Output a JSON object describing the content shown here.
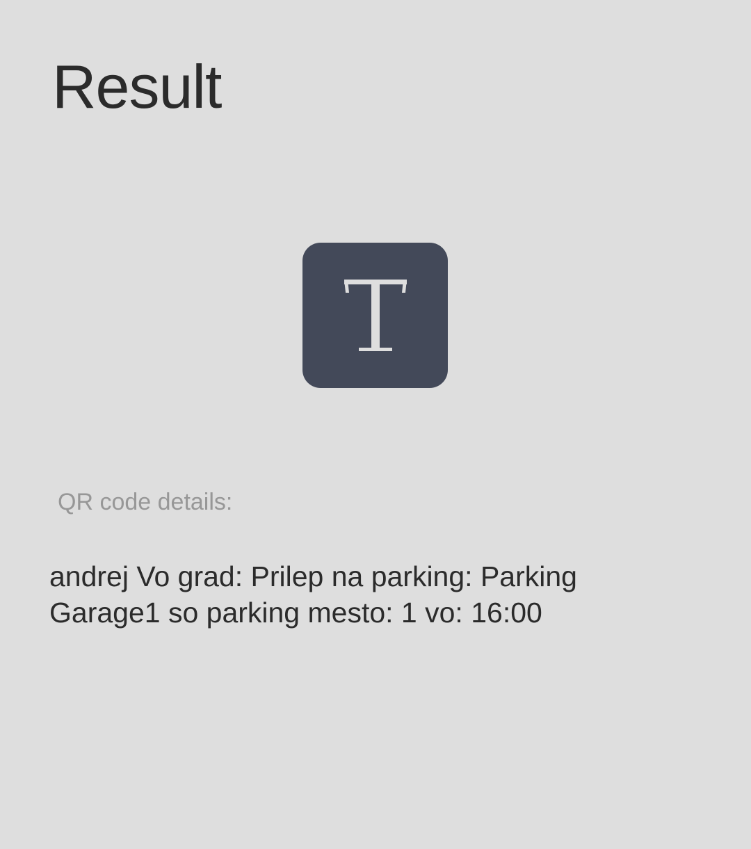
{
  "screen": {
    "title": "Result",
    "type_icon": {
      "name": "text-type-icon",
      "glyph": "T",
      "background": "#434959",
      "glyph_color": "#dedede"
    },
    "details_label": "QR code details:",
    "details_text": "andrej Vo grad: Prilep na parking: Parking Garage1 so parking mesto: 1 vo: 16:00"
  },
  "colors": {
    "background": "#dedede",
    "primary_text": "#2b2b2b",
    "secondary_text": "#979797"
  }
}
